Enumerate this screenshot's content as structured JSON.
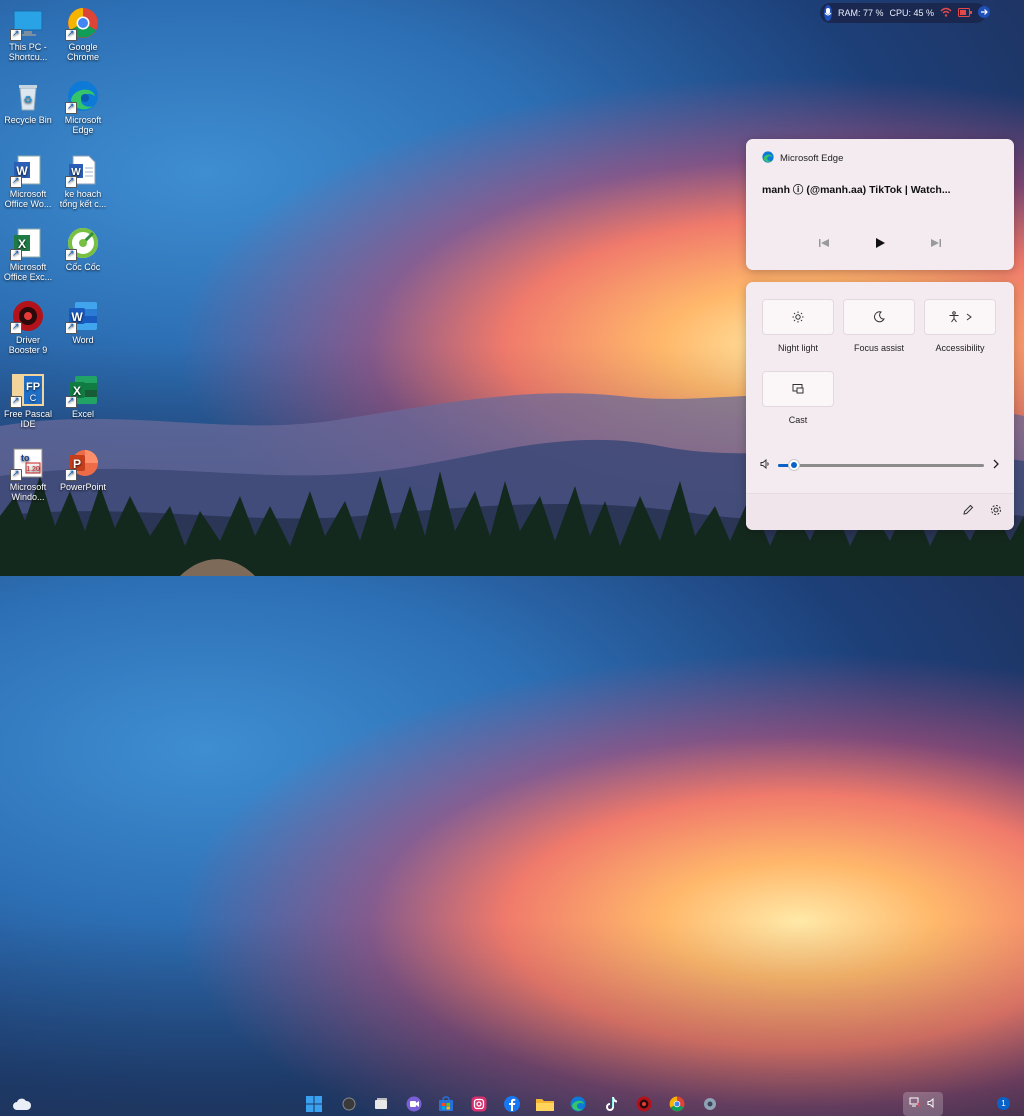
{
  "desktop": {
    "icons": [
      {
        "label": "This PC -\nShortcu...",
        "icon": "monitor-icon"
      },
      {
        "label": "Google\nChrome",
        "icon": "chrome-icon"
      },
      {
        "label": "Recycle Bin",
        "icon": "recycle-bin-icon"
      },
      {
        "label": "Microsoft\nEdge",
        "icon": "edge-icon"
      },
      {
        "label": "Microsoft\nOffice Wo...",
        "icon": "word-doc-icon"
      },
      {
        "label": "ke hoach\ntổng kết c...",
        "icon": "word-file-icon"
      },
      {
        "label": "Microsoft\nOffice Exc...",
        "icon": "excel-doc-icon"
      },
      {
        "label": "Cốc Cốc",
        "icon": "coccoc-icon"
      },
      {
        "label": "Driver\nBooster 9",
        "icon": "driver-booster-icon"
      },
      {
        "label": "Word",
        "icon": "word-icon"
      },
      {
        "label": "Free Pascal\nIDE",
        "icon": "free-pascal-icon"
      },
      {
        "label": "Excel",
        "icon": "excel-icon"
      },
      {
        "label": "Microsoft\nWindo...",
        "icon": "windows-app-icon"
      },
      {
        "label": "PowerPoint",
        "icon": "powerpoint-icon"
      }
    ]
  },
  "status_widget": {
    "ram": "RAM: 77 %",
    "cpu": "CPU: 45 %"
  },
  "media": {
    "app_name": "Microsoft Edge",
    "title": "manh ⓘ (@manh.aa) TikTok | Watch..."
  },
  "quick_settings": {
    "tiles": [
      {
        "label": "Night light",
        "icon": "brightness-icon"
      },
      {
        "label": "Focus assist",
        "icon": "moon-icon"
      },
      {
        "label": "Accessibility",
        "icon": "accessibility-icon"
      },
      {
        "label": "Cast",
        "icon": "cast-icon"
      }
    ],
    "volume": 0.08
  },
  "taskbar": {
    "notification_count": "1"
  }
}
